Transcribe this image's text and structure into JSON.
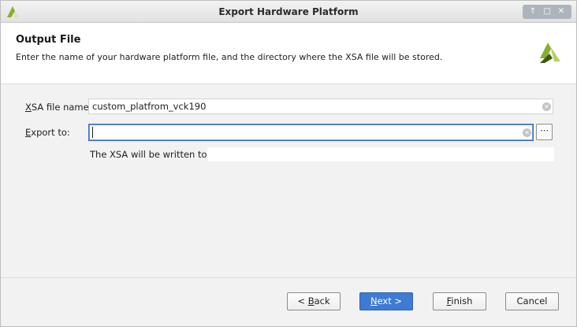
{
  "window": {
    "title": "Export Hardware Platform",
    "controls": [
      "↑",
      "□",
      "✕"
    ]
  },
  "header": {
    "title": "Output File",
    "description": "Enter the name of your hardware platform file, and the directory where the XSA file will be stored."
  },
  "form": {
    "xsa_label_mnemonic": "X",
    "xsa_label_rest": "SA file name:",
    "xsa_value": "custom_platfrom_vck190",
    "export_label_mnemonic": "E",
    "export_label_rest": "xport to:",
    "export_value": "",
    "browse_label": "⋯",
    "write_note": "The XSA will be written to:",
    "write_path": ""
  },
  "buttons": {
    "back_prefix": "< ",
    "back_mnemonic": "B",
    "back_rest": "ack",
    "next_mnemonic": "N",
    "next_rest": "ext >",
    "finish_mnemonic": "F",
    "finish_rest": "inish",
    "cancel": "Cancel"
  },
  "colors": {
    "accent": "#3d7bd4",
    "logo_green": "#86b02c",
    "logo_dark": "#3c5a12"
  }
}
